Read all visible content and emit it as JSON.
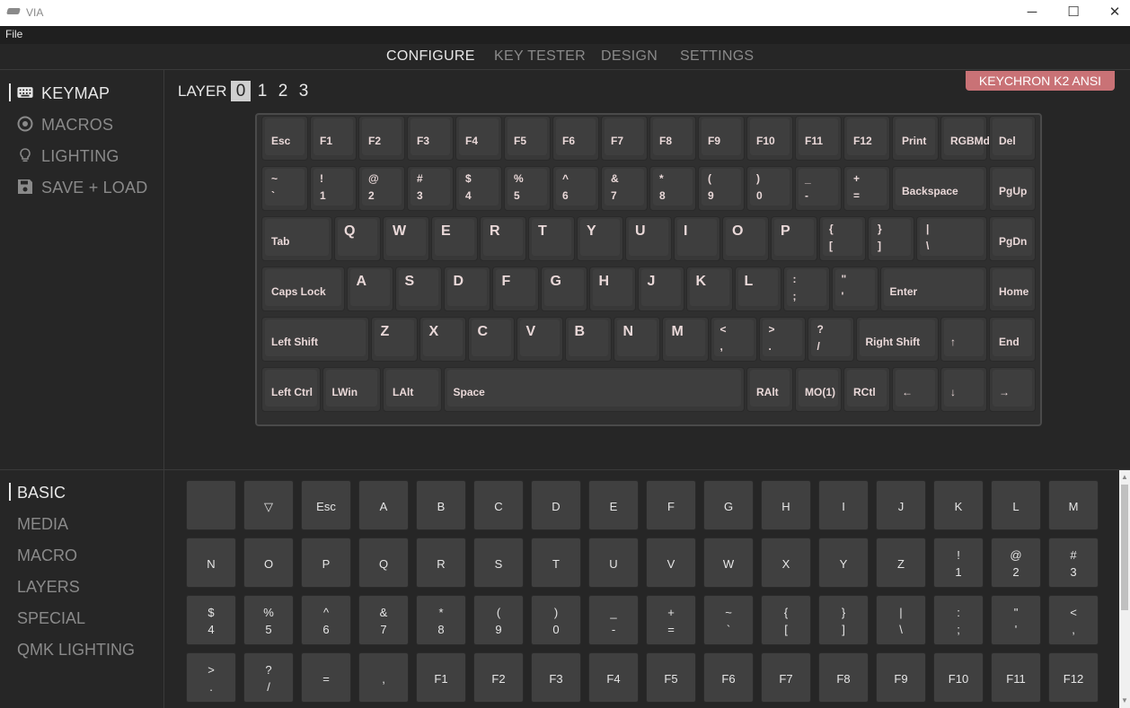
{
  "window": {
    "title": "VIA"
  },
  "menu": {
    "file": "File"
  },
  "nav": {
    "configure": "CONFIGURE",
    "key_tester": "KEY TESTER",
    "design": "DESIGN",
    "settings": "SETTINGS"
  },
  "sidebar": {
    "keymap": "KEYMAP",
    "macros": "MACROS",
    "lighting": "LIGHTING",
    "save_load": "SAVE + LOAD"
  },
  "layers": {
    "label": "LAYER",
    "items": [
      "0",
      "1",
      "2",
      "3"
    ],
    "active": "0"
  },
  "keyboard_name": "KEYCHRON K2 ANSI",
  "categories": {
    "basic": "BASIC",
    "media": "MEDIA",
    "macro": "MACRO",
    "layers": "LAYERS",
    "special": "SPECIAL",
    "qmk_lighting": "QMK LIGHTING"
  },
  "keyboard_rows": [
    [
      {
        "l": "Esc"
      },
      {
        "l": "F1"
      },
      {
        "l": "F2"
      },
      {
        "l": "F3"
      },
      {
        "l": "F4"
      },
      {
        "l": "F5"
      },
      {
        "l": "F6"
      },
      {
        "l": "F7"
      },
      {
        "l": "F8"
      },
      {
        "l": "F9"
      },
      {
        "l": "F10"
      },
      {
        "l": "F11"
      },
      {
        "l": "F12"
      },
      {
        "l": "Print"
      },
      {
        "l": "RGBMd-"
      },
      {
        "l": "Del"
      }
    ],
    [
      {
        "t": "~",
        "b": "`"
      },
      {
        "t": "!",
        "b": "1"
      },
      {
        "t": "@",
        "b": "2"
      },
      {
        "t": "#",
        "b": "3"
      },
      {
        "t": "$",
        "b": "4"
      },
      {
        "t": "%",
        "b": "5"
      },
      {
        "t": "^",
        "b": "6"
      },
      {
        "t": "&",
        "b": "7"
      },
      {
        "t": "*",
        "b": "8"
      },
      {
        "t": "(",
        "b": "9"
      },
      {
        "t": ")",
        "b": "0"
      },
      {
        "t": "_",
        "b": "-"
      },
      {
        "t": "+",
        "b": "="
      },
      {
        "l": "Backspace"
      },
      {
        "l": "PgUp"
      }
    ],
    [
      {
        "l": "Tab"
      },
      {
        "c": "Q"
      },
      {
        "c": "W"
      },
      {
        "c": "E"
      },
      {
        "c": "R"
      },
      {
        "c": "T"
      },
      {
        "c": "Y"
      },
      {
        "c": "U"
      },
      {
        "c": "I"
      },
      {
        "c": "O"
      },
      {
        "c": "P"
      },
      {
        "t": "{",
        "b": "["
      },
      {
        "t": "}",
        "b": "]"
      },
      {
        "t": "|",
        "b": "\\"
      },
      {
        "l": "PgDn"
      }
    ],
    [
      {
        "l": "Caps Lock"
      },
      {
        "c": "A"
      },
      {
        "c": "S"
      },
      {
        "c": "D"
      },
      {
        "c": "F"
      },
      {
        "c": "G"
      },
      {
        "c": "H"
      },
      {
        "c": "J"
      },
      {
        "c": "K"
      },
      {
        "c": "L"
      },
      {
        "t": ":",
        "b": ";"
      },
      {
        "t": "\"",
        "b": "'"
      },
      {
        "l": "Enter"
      },
      {
        "l": "Home"
      }
    ],
    [
      {
        "l": "Left Shift"
      },
      {
        "c": "Z"
      },
      {
        "c": "X"
      },
      {
        "c": "C"
      },
      {
        "c": "V"
      },
      {
        "c": "B"
      },
      {
        "c": "N"
      },
      {
        "c": "M"
      },
      {
        "t": "<",
        "b": ","
      },
      {
        "t": ">",
        "b": "."
      },
      {
        "t": "?",
        "b": "/"
      },
      {
        "l": "Right Shift"
      },
      {
        "l": "↑"
      },
      {
        "l": "End"
      }
    ],
    [
      {
        "l": "Left Ctrl"
      },
      {
        "l": "LWin"
      },
      {
        "l": "LAlt"
      },
      {
        "l": "Space"
      },
      {
        "l": "RAlt"
      },
      {
        "l": "MO(1)"
      },
      {
        "l": "RCtl"
      },
      {
        "l": "←"
      },
      {
        "l": "↓"
      },
      {
        "l": "→"
      }
    ]
  ],
  "picker_rows": [
    [
      {
        "l": ""
      },
      {
        "l": "▽"
      },
      {
        "l": "Esc"
      },
      {
        "l": "A"
      },
      {
        "l": "B"
      },
      {
        "l": "C"
      },
      {
        "l": "D"
      },
      {
        "l": "E"
      },
      {
        "l": "F"
      },
      {
        "l": "G"
      },
      {
        "l": "H"
      },
      {
        "l": "I"
      },
      {
        "l": "J"
      },
      {
        "l": "K"
      },
      {
        "l": "L"
      },
      {
        "l": "M"
      }
    ],
    [
      {
        "l": "N"
      },
      {
        "l": "O"
      },
      {
        "l": "P"
      },
      {
        "l": "Q"
      },
      {
        "l": "R"
      },
      {
        "l": "S"
      },
      {
        "l": "T"
      },
      {
        "l": "U"
      },
      {
        "l": "V"
      },
      {
        "l": "W"
      },
      {
        "l": "X"
      },
      {
        "l": "Y"
      },
      {
        "l": "Z"
      },
      {
        "t": "!",
        "b": "1"
      },
      {
        "t": "@",
        "b": "2"
      },
      {
        "t": "#",
        "b": "3"
      }
    ],
    [
      {
        "t": "$",
        "b": "4"
      },
      {
        "t": "%",
        "b": "5"
      },
      {
        "t": "^",
        "b": "6"
      },
      {
        "t": "&",
        "b": "7"
      },
      {
        "t": "*",
        "b": "8"
      },
      {
        "t": "(",
        "b": "9"
      },
      {
        "t": ")",
        "b": "0"
      },
      {
        "t": "_",
        "b": "-"
      },
      {
        "t": "+",
        "b": "="
      },
      {
        "t": "~",
        "b": "`"
      },
      {
        "t": "{",
        "b": "["
      },
      {
        "t": "}",
        "b": "]"
      },
      {
        "t": "|",
        "b": "\\"
      },
      {
        "t": ":",
        "b": ";"
      },
      {
        "t": "\"",
        "b": "'"
      },
      {
        "t": "<",
        "b": ","
      }
    ],
    [
      {
        "t": ">",
        "b": "."
      },
      {
        "t": "?",
        "b": "/"
      },
      {
        "l": "="
      },
      {
        "l": ","
      },
      {
        "l": "F1"
      },
      {
        "l": "F2"
      },
      {
        "l": "F3"
      },
      {
        "l": "F4"
      },
      {
        "l": "F5"
      },
      {
        "l": "F6"
      },
      {
        "l": "F7"
      },
      {
        "l": "F8"
      },
      {
        "l": "F9"
      },
      {
        "l": "F10"
      },
      {
        "l": "F11"
      },
      {
        "l": "F12"
      }
    ]
  ]
}
